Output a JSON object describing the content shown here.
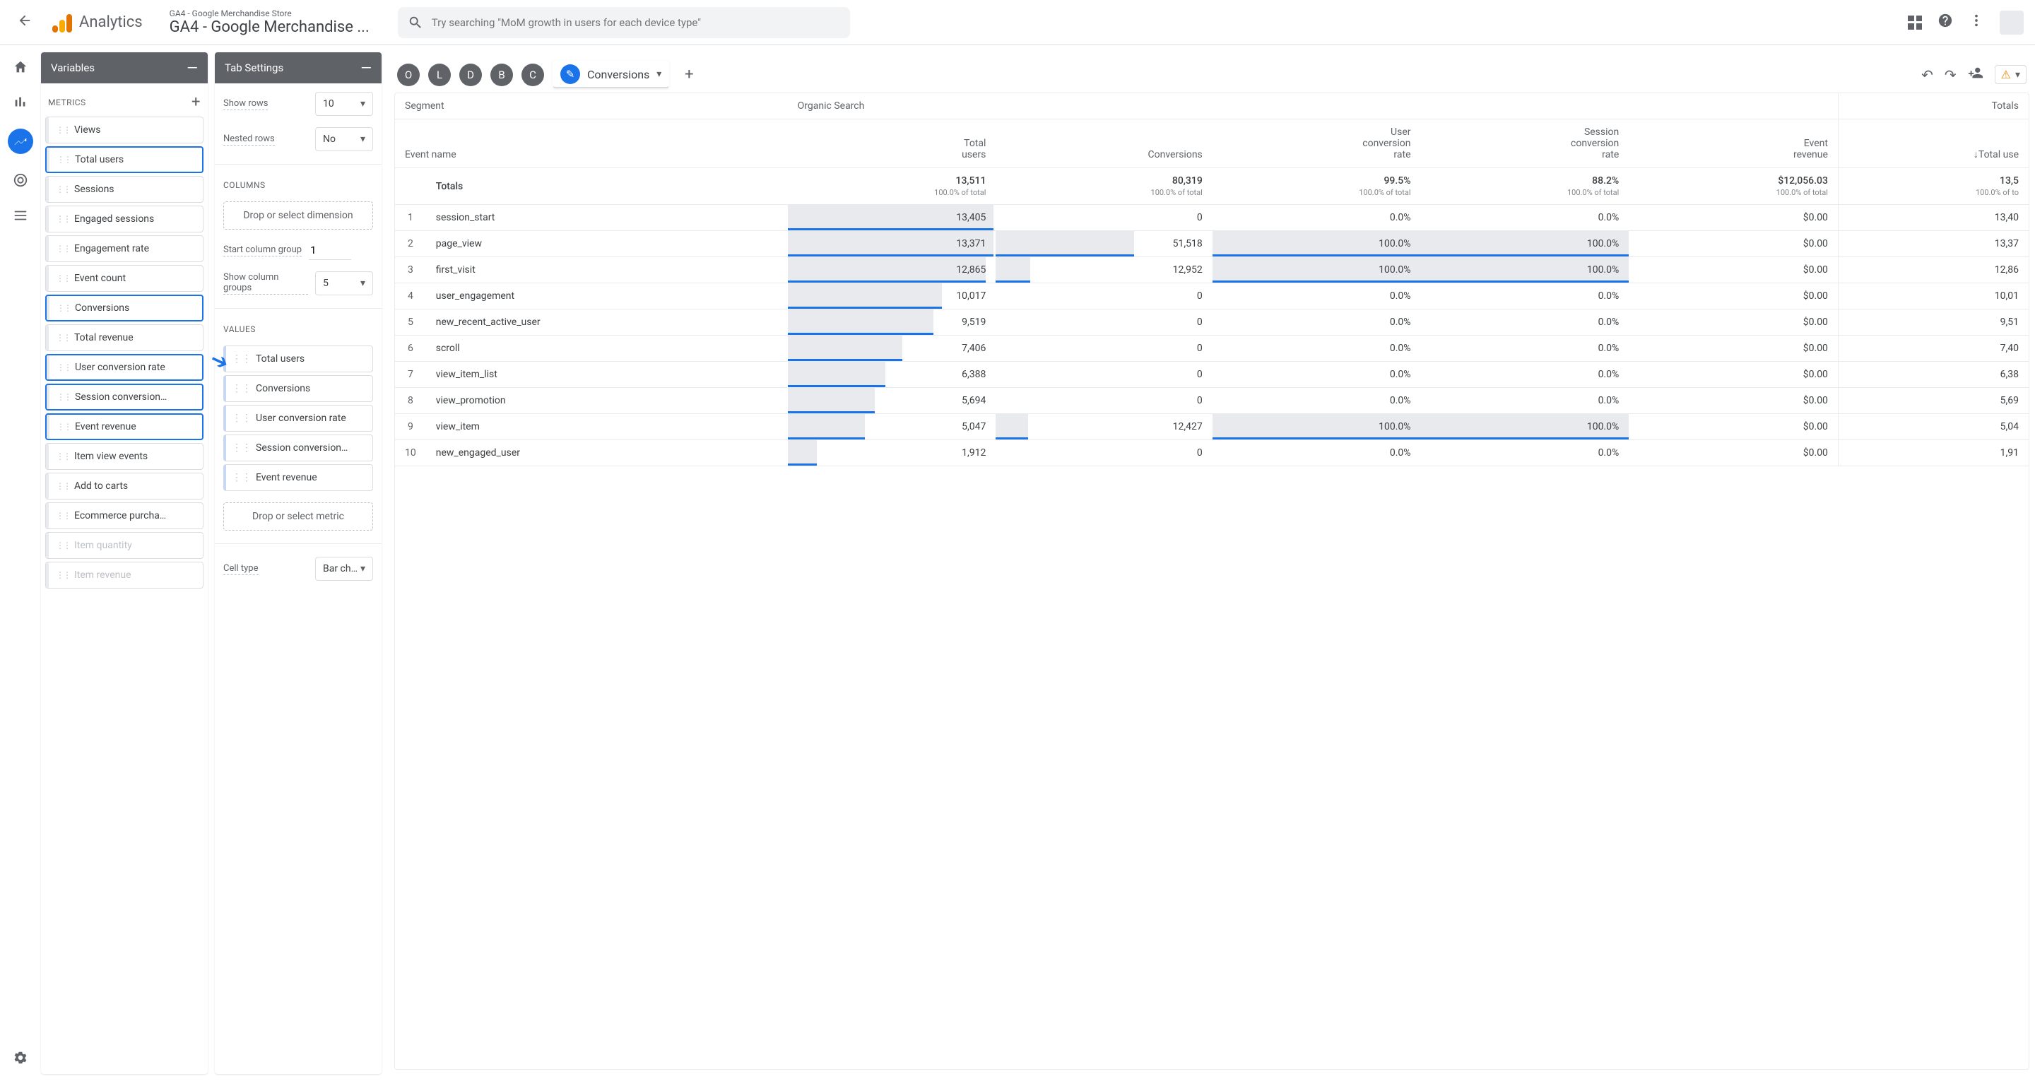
{
  "header": {
    "analytics_label": "Analytics",
    "property_small": "GA4 - Google Merchandise Store",
    "property_big": "GA4 - Google Merchandise ...",
    "search_placeholder": "Try searching \"MoM growth in users for each device type\""
  },
  "variables_panel": {
    "title": "Variables",
    "metrics_label": "METRICS",
    "metrics": [
      {
        "label": "Views",
        "hl": false
      },
      {
        "label": "Total users",
        "hl": true
      },
      {
        "label": "Sessions",
        "hl": false
      },
      {
        "label": "Engaged sessions",
        "hl": false
      },
      {
        "label": "Engagement rate",
        "hl": false
      },
      {
        "label": "Event count",
        "hl": false
      },
      {
        "label": "Conversions",
        "hl": true
      },
      {
        "label": "Total revenue",
        "hl": false
      },
      {
        "label": "User conversion rate",
        "hl": true
      },
      {
        "label": "Session conversion…",
        "hl": true
      },
      {
        "label": "Event revenue",
        "hl": true
      },
      {
        "label": "Item view events",
        "hl": false
      },
      {
        "label": "Add to carts",
        "hl": false
      },
      {
        "label": "Ecommerce purcha…",
        "hl": false
      },
      {
        "label": "Item quantity",
        "hl": false,
        "dim": true
      },
      {
        "label": "Item revenue",
        "hl": false,
        "dim": true
      }
    ]
  },
  "tab_settings": {
    "title": "Tab Settings",
    "show_rows_label": "Show rows",
    "show_rows_value": "10",
    "nested_rows_label": "Nested rows",
    "nested_rows_value": "No",
    "columns_label": "COLUMNS",
    "drop_dimension": "Drop or select dimension",
    "start_col_label": "Start column group",
    "start_col_value": "1",
    "show_col_groups_label": "Show column groups",
    "show_col_groups_value": "5",
    "values_label": "VALUES",
    "values": [
      "Total users",
      "Conversions",
      "User conversion rate",
      "Session conversion…",
      "Event revenue"
    ],
    "drop_metric": "Drop or select metric",
    "cell_type_label": "Cell type",
    "cell_type_value": "Bar ch…"
  },
  "tabs": {
    "letters": [
      "O",
      "L",
      "D",
      "B",
      "C"
    ],
    "active": "Conversions"
  },
  "table": {
    "segment_label": "Segment",
    "segment_value": "Organic Search",
    "event_name_label": "Event name",
    "columns": [
      "Total users",
      "Conversions",
      "User conversion rate",
      "Session conversion rate",
      "Event revenue"
    ],
    "totals_label": "Totals",
    "totals_header_right": "Totals",
    "totals_sort_col": "↓Total use",
    "totals": {
      "vals": [
        "13,511",
        "80,319",
        "99.5%",
        "88.2%",
        "$12,056.03"
      ],
      "sub": "100.0% of total",
      "totals_right": "13,5",
      "totals_right_sub": "100.0% of to"
    },
    "rows": [
      {
        "i": 1,
        "name": "session_start",
        "vals": [
          "13,405",
          "0",
          "0.0%",
          "0.0%",
          "$0.00"
        ],
        "bars": [
          99,
          0,
          0,
          0,
          0
        ],
        "totR": "13,40"
      },
      {
        "i": 2,
        "name": "page_view",
        "vals": [
          "13,371",
          "51,518",
          "100.0%",
          "100.0%",
          "$0.00"
        ],
        "bars": [
          99,
          64,
          100,
          100,
          0
        ],
        "totR": "13,37"
      },
      {
        "i": 3,
        "name": "first_visit",
        "vals": [
          "12,865",
          "12,952",
          "100.0%",
          "100.0%",
          "$0.00"
        ],
        "bars": [
          95,
          16,
          100,
          100,
          0
        ],
        "totR": "12,86"
      },
      {
        "i": 4,
        "name": "user_engagement",
        "vals": [
          "10,017",
          "0",
          "0.0%",
          "0.0%",
          "$0.00"
        ],
        "bars": [
          74,
          0,
          0,
          0,
          0
        ],
        "totR": "10,01"
      },
      {
        "i": 5,
        "name": "new_recent_active_user",
        "vals": [
          "9,519",
          "0",
          "0.0%",
          "0.0%",
          "$0.00"
        ],
        "bars": [
          70,
          0,
          0,
          0,
          0
        ],
        "totR": "9,51"
      },
      {
        "i": 6,
        "name": "scroll",
        "vals": [
          "7,406",
          "0",
          "0.0%",
          "0.0%",
          "$0.00"
        ],
        "bars": [
          55,
          0,
          0,
          0,
          0
        ],
        "totR": "7,40"
      },
      {
        "i": 7,
        "name": "view_item_list",
        "vals": [
          "6,388",
          "0",
          "0.0%",
          "0.0%",
          "$0.00"
        ],
        "bars": [
          47,
          0,
          0,
          0,
          0
        ],
        "totR": "6,38"
      },
      {
        "i": 8,
        "name": "view_promotion",
        "vals": [
          "5,694",
          "0",
          "0.0%",
          "0.0%",
          "$0.00"
        ],
        "bars": [
          42,
          0,
          0,
          0,
          0
        ],
        "totR": "5,69"
      },
      {
        "i": 9,
        "name": "view_item",
        "vals": [
          "5,047",
          "12,427",
          "100.0%",
          "100.0%",
          "$0.00"
        ],
        "bars": [
          37,
          15,
          100,
          100,
          0
        ],
        "totR": "5,04"
      },
      {
        "i": 10,
        "name": "new_engaged_user",
        "vals": [
          "1,912",
          "0",
          "0.0%",
          "0.0%",
          "$0.00"
        ],
        "bars": [
          14,
          0,
          0,
          0,
          0
        ],
        "totR": "1,91"
      }
    ]
  }
}
